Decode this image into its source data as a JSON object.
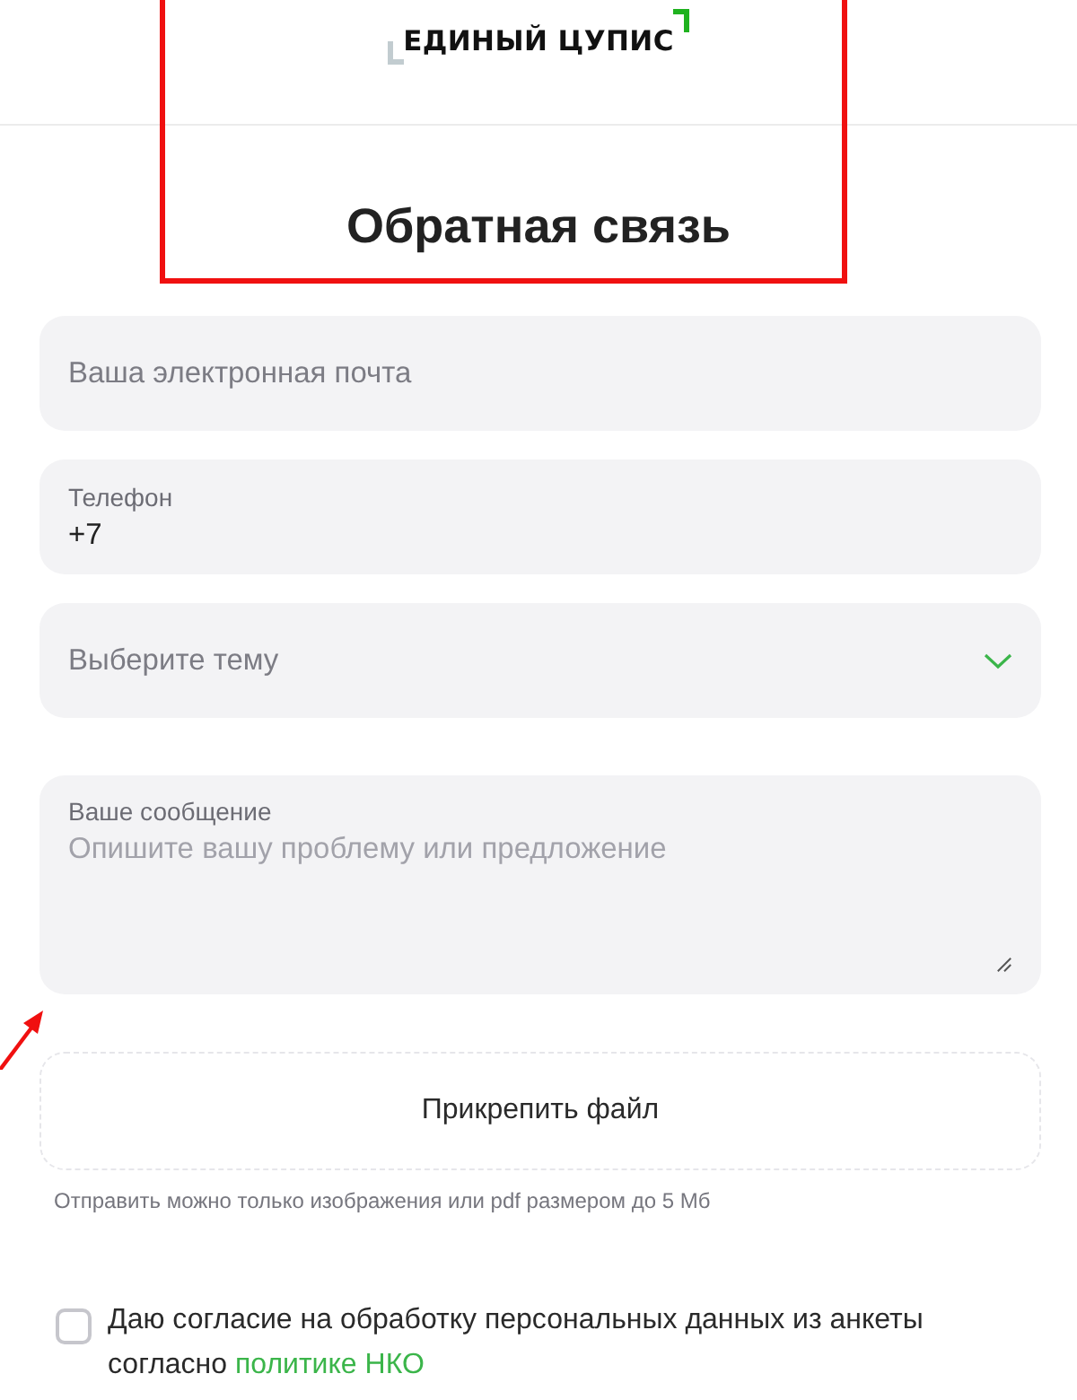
{
  "header": {
    "logo": "ЕДИНЫЙ ЦУПИС"
  },
  "title": "Обратная связь",
  "fields": [
    {
      "kind": "text",
      "placeholder": "Ваша электронная почта"
    },
    {
      "kind": "labeled",
      "label": "Телефон",
      "value": "+7"
    },
    {
      "kind": "select",
      "placeholder": "Выберите тему"
    },
    {
      "kind": "textarea",
      "label": "Ваше сообщение",
      "placeholder": "Опишите вашу проблему или предложение"
    }
  ],
  "attach": {
    "label": "Прикрепить файл",
    "hint": "Отправить можно только изображения или pdf размером до 5 Мб"
  },
  "consent": {
    "checked": false,
    "text": "Даю согласие на обработку персональных данных из анкеты согласно ",
    "link": "политике НКО"
  },
  "annotations": {
    "frame": true,
    "arrow": true
  }
}
